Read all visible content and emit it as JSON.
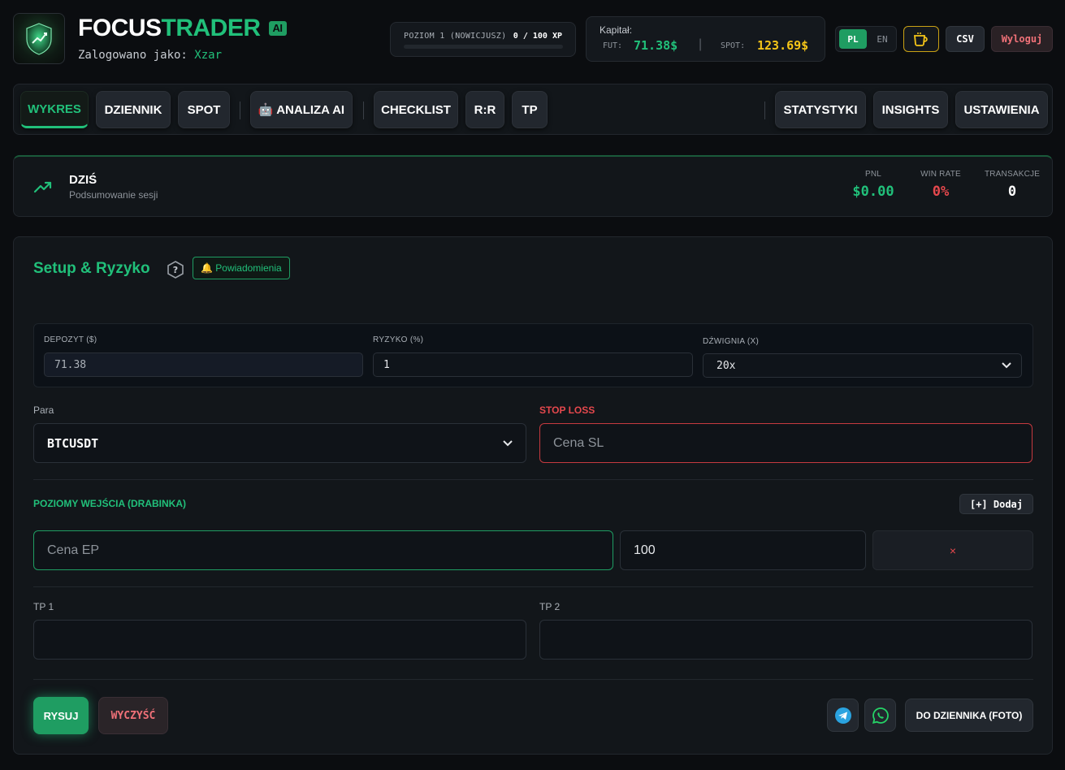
{
  "header": {
    "brand_part1": "FOCUS",
    "brand_part2": "TRADER",
    "ai_badge": "AI",
    "logged_prefix": "Zalogowano jako:",
    "username": "Xzar",
    "level_label": "POZIOM 1 (NOWICJUSZ)",
    "xp_text": "0 / 100 XP",
    "xp_progress": 0,
    "capital_title": "Kapitał:",
    "fut_label": "FUT:",
    "fut_value": "71.38$",
    "separator": "|",
    "spot_label": "SPOT:",
    "spot_value": "123.69$",
    "lang_pl": "PL",
    "lang_en": "EN",
    "csv_label": "CSV",
    "logout_label": "Wyloguj"
  },
  "nav": {
    "items": [
      {
        "label": "WYKRES"
      },
      {
        "label": "DZIENNIK"
      },
      {
        "label": "SPOT"
      },
      {
        "label": "🤖 ANALIZA AI"
      },
      {
        "label": "CHECKLIST"
      },
      {
        "label": "R:R"
      },
      {
        "label": "TP"
      },
      {
        "label": "STATYSTYKI"
      },
      {
        "label": "INSIGHTS"
      },
      {
        "label": "USTAWIENIA"
      }
    ]
  },
  "today": {
    "title": "DZIŚ",
    "subtitle": "Podsumowanie sesji",
    "pnl_label": "PNL",
    "pnl_value": "$0.00",
    "winrate_label": "WIN RATE",
    "winrate_value": "0%",
    "trades_label": "TRANSAKCJE",
    "trades_value": "0"
  },
  "setup": {
    "title": "Setup & Ryzyko",
    "notifications_label": "🔔 Powiadomienia",
    "deposit_label": "DEPOZYT ($)",
    "deposit_value": "71.38",
    "risk_label": "RYZYKO (%)",
    "risk_value": "1",
    "leverage_label": "DŹWIGNIA (X)",
    "leverage_value": "20x",
    "pair_label": "Para",
    "pair_value": "BTCUSDT",
    "sl_label": "STOP LOSS",
    "sl_placeholder": "Cena SL",
    "entry_label": "POZIOMY WEJŚCIA (DRABINKA)",
    "add_label": "[+] Dodaj",
    "ep_placeholder": "Cena EP",
    "ep_size": "100",
    "remove_symbol": "×",
    "tp1_label": "TP 1",
    "tp2_label": "TP 2",
    "draw_label": "RYSUJ",
    "clear_label": "WYCZYŚĆ",
    "journal_label": "DO DZIENNIKA (FOTO)"
  },
  "colors": {
    "accent": "#21c07a",
    "danger": "#e5484d",
    "gold": "#f5c518"
  }
}
